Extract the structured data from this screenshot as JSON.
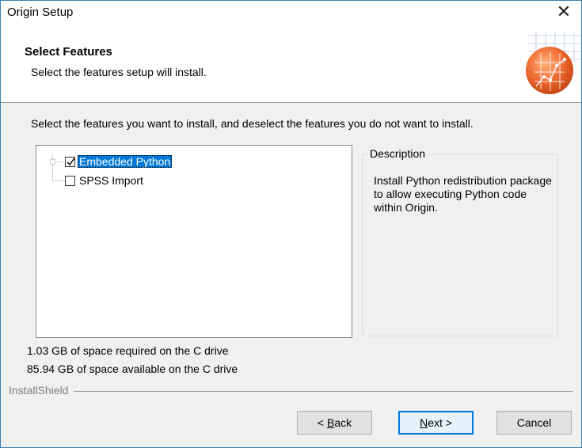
{
  "window": {
    "title": "Origin Setup"
  },
  "header": {
    "title": "Select Features",
    "subtitle": "Select the features setup will install."
  },
  "instructions": "Select the features you want to install, and deselect the features you do not want to install.",
  "features": [
    {
      "label": "Embedded Python",
      "checked": true,
      "selected": true
    },
    {
      "label": "SPSS Import",
      "checked": false,
      "selected": false
    }
  ],
  "description": {
    "legend": "Description",
    "text": "Install Python redistribution package to allow executing Python code within Origin."
  },
  "space": {
    "required": "1.03 GB of space required on the C drive",
    "available": "85.94 GB of space available on the C drive"
  },
  "brand": "InstallShield",
  "buttons": {
    "back": {
      "prefix": "< ",
      "mnemonic": "B",
      "rest": "ack"
    },
    "next": {
      "mnemonic": "N",
      "rest": "ext >"
    },
    "cancel": "Cancel"
  },
  "icons": {
    "close": "close-icon",
    "logo": "origin-logo-icon"
  },
  "colors": {
    "accent": "#0078d7",
    "logo_orange": "#ee6a2f"
  }
}
